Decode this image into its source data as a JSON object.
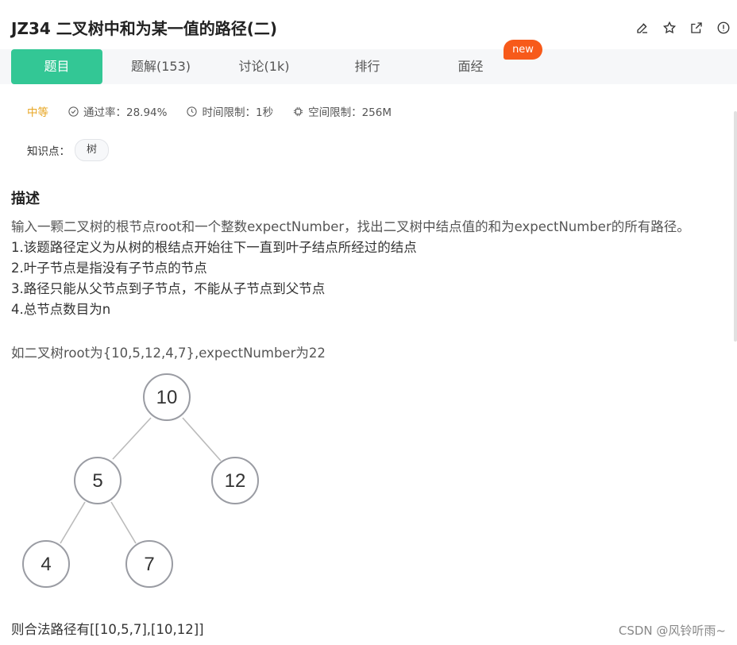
{
  "header": {
    "title": "JZ34  二叉树中和为某一值的路径(二)",
    "icons": [
      "edit-icon",
      "star-icon",
      "external-link-icon",
      "info-icon"
    ]
  },
  "tabs": [
    {
      "label": "题目",
      "active": true
    },
    {
      "label": "题解(153)",
      "active": false
    },
    {
      "label": "讨论(1k)",
      "active": false
    },
    {
      "label": "排行",
      "active": false
    },
    {
      "label": "面经",
      "active": false
    }
  ],
  "new_badge": "new",
  "meta": {
    "difficulty": "中等",
    "pass_rate": "通过率：28.94%",
    "time_limit": "时间限制：1秒",
    "space_limit": "空间限制：256M"
  },
  "knowledge": {
    "label": "知识点：",
    "tags": [
      "树"
    ]
  },
  "description": {
    "title": "描述",
    "lines": [
      "输入一颗二叉树的根节点root和一个整数expectNumber，找出二叉树中结点值的和为expectNumber的所有路径。",
      "1.该题路径定义为从树的根结点开始往下一直到叶子结点所经过的结点",
      "2.叶子节点是指没有子节点的节点",
      "3.路径只能从父节点到子节点，不能从子节点到父节点",
      "4.总节点数目为n"
    ],
    "example": "如二叉树root为{10,5,12,4,7},expectNumber为22",
    "tree_nodes": [
      "10",
      "5",
      "12",
      "4",
      "7"
    ],
    "result": "则合法路径有[[10,5,7],[10,12]]"
  },
  "watermark": "CSDN @风铃听雨~",
  "colors": {
    "accent": "#33c795",
    "badge": "#f75a1a",
    "difficulty": "#e7a623"
  }
}
